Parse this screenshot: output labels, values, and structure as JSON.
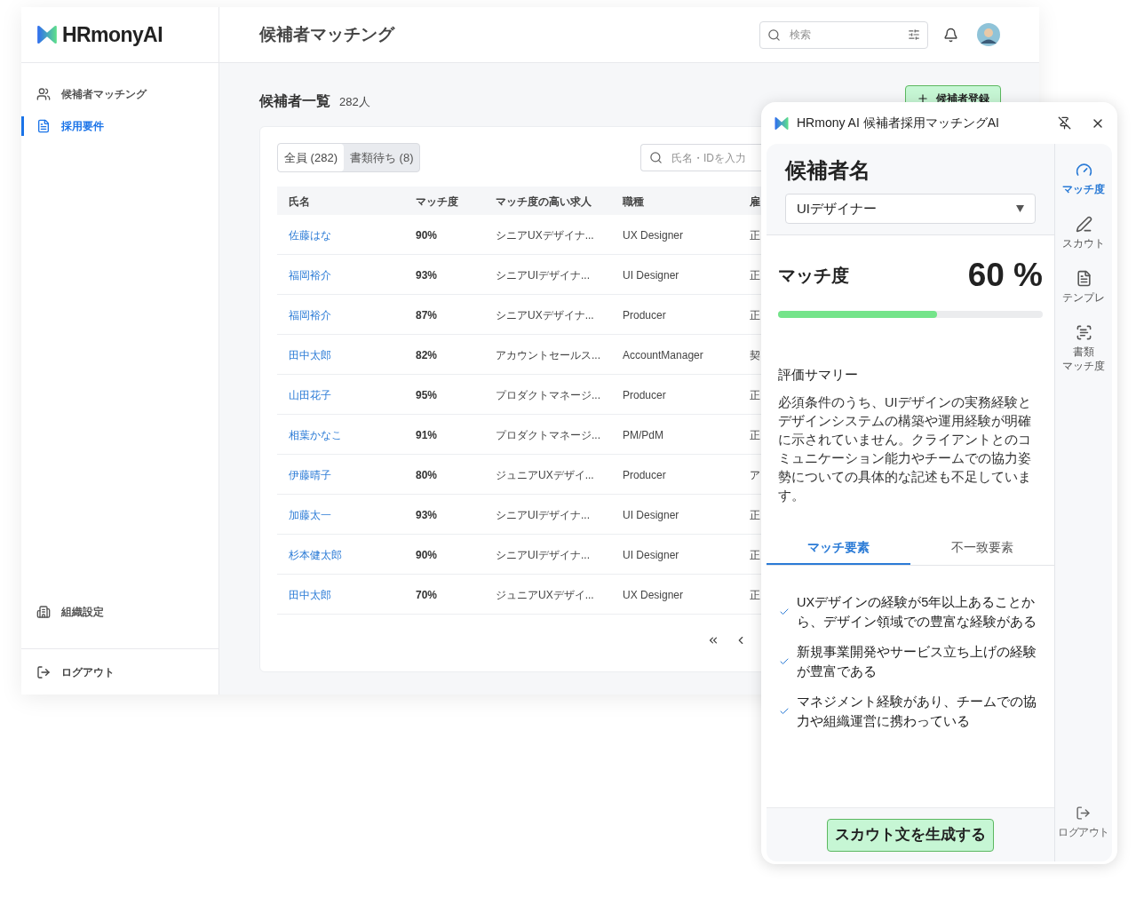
{
  "app": {
    "logo": "HRmonyAI",
    "page_title": "候補者マッチング",
    "search": {
      "placeholder": "検索"
    }
  },
  "sidebar": {
    "items": [
      {
        "label": "候補者マッチング",
        "selected": false
      },
      {
        "label": "採用要件",
        "selected": true
      }
    ],
    "settings": "組織設定",
    "logout": "ログアウト"
  },
  "list": {
    "title": "候補者一覧",
    "count": "282人",
    "add_button": "候補者登録",
    "filters": [
      {
        "label": "全員 (282)",
        "selected": true
      },
      {
        "label": "書類待ち (8)",
        "selected": false
      }
    ],
    "search": {
      "placeholder": "氏名・IDを入力"
    }
  },
  "table": {
    "columns": [
      "氏名",
      "マッチ度",
      "マッチ度の高い求人",
      "職種",
      "雇"
    ],
    "rows": [
      [
        "佐藤はな",
        "90%",
        "シニアUXデザイナ...",
        "UX Designer",
        "正"
      ],
      [
        "福岡裕介",
        "93%",
        "シニアUIデザイナ...",
        "UI Designer",
        "正"
      ],
      [
        "福岡裕介",
        "87%",
        "シニアUXデザイナ...",
        "Producer",
        "正"
      ],
      [
        "田中太郎",
        "82%",
        "アカウントセールス...",
        "AccountManager",
        "契"
      ],
      [
        "山田花子",
        "95%",
        "プロダクトマネージ...",
        "Producer",
        "正"
      ],
      [
        "相葉かなこ",
        "91%",
        "プロダクトマネージ...",
        "PM/PdM",
        "正"
      ],
      [
        "伊藤晴子",
        "80%",
        "ジュニアUXデザイ...",
        "Producer",
        "ア"
      ],
      [
        "加藤太一",
        "93%",
        "シニアUIデザイナ...",
        "UI Designer",
        "正"
      ],
      [
        "杉本健太郎",
        "90%",
        "シニアUIデザイナ...",
        "UI Designer",
        "正"
      ],
      [
        "田中太郎",
        "70%",
        "ジュニアUXデザイ...",
        "UX Designer",
        "正"
      ]
    ]
  },
  "panel": {
    "title": "HRmony AI 候補者採用マッチングAI",
    "heading": "候補者名",
    "job_select": "UIデザイナー",
    "match_label": "マッチ度",
    "match_value": "60 %",
    "level": 0.6,
    "summary_title": "評価サマリー",
    "summary": "必須条件のうち、UIデザインの実務経験とデザインシステムの構築や運用経験が明確に示されていません。クライアントとのコミュニケーション能力やチームでの協力姿勢についての具体的な記述も不足しています。",
    "tabs": [
      {
        "label": "マッチ要素",
        "selected": true
      },
      {
        "label": "不一致要素",
        "selected": false
      }
    ],
    "items": [
      "UXデザインの経験が5年以上あることから、デザイン領域での豊富な経験がある",
      "新規事業開発やサービス立ち上げの経験が豊富である",
      "マネジメント経験があり、チームでの協力や組織運営に携わっている"
    ],
    "generate_button": "スカウト文を生成する",
    "rail": [
      {
        "lines": [
          "マッチ度"
        ],
        "selected": true
      },
      {
        "lines": [
          "スカウト"
        ],
        "selected": false
      },
      {
        "lines": [
          "テンプレ"
        ],
        "selected": false
      },
      {
        "lines": [
          "書類",
          "マッチ度"
        ],
        "selected": false
      }
    ],
    "rail_logout": "ログアウト"
  }
}
